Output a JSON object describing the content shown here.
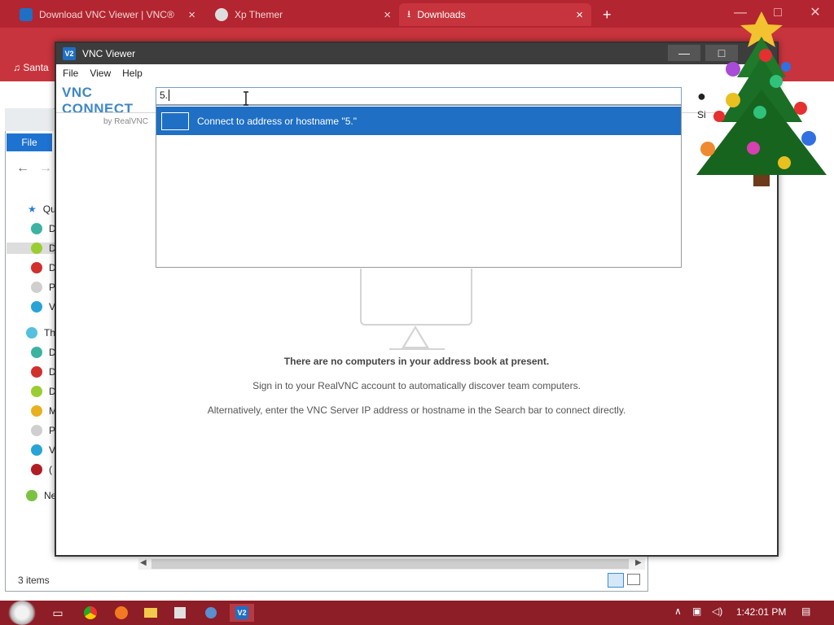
{
  "browser": {
    "tabs": [
      {
        "label": "Download VNC Viewer | VNC®",
        "active": false
      },
      {
        "label": "Xp Themer",
        "active": false
      },
      {
        "label": "Downloads",
        "active": true
      }
    ],
    "bookmark": "Santa"
  },
  "explorer": {
    "file_tab": "File",
    "items": [
      "Qu",
      "D",
      "D",
      "D",
      "P",
      "V",
      "Th",
      "D",
      "D",
      "D",
      "M",
      "P",
      "V",
      "(",
      "Ne"
    ],
    "status": "3 items"
  },
  "vnc": {
    "title": "VNC Viewer",
    "menu": [
      "File",
      "View",
      "Help"
    ],
    "logo_text": "VNC CONNECT",
    "logo_sub": "by RealVNC",
    "search_value": "5.",
    "suggestion": "Connect to address or hostname \"5.\"",
    "signin_partial": "Si",
    "empty_title": "There are no computers in your address book at present.",
    "empty_line1": "Sign in to your RealVNC account to automatically discover team computers.",
    "empty_line2": "Alternatively, enter the VNC Server IP address or hostname in the Search bar to connect directly."
  },
  "taskbar": {
    "clock": "1:42:01 PM"
  },
  "colors": {
    "accent": "#1f6fc4",
    "browser_red": "#c8343d",
    "taskbar": "#8d1d26"
  }
}
